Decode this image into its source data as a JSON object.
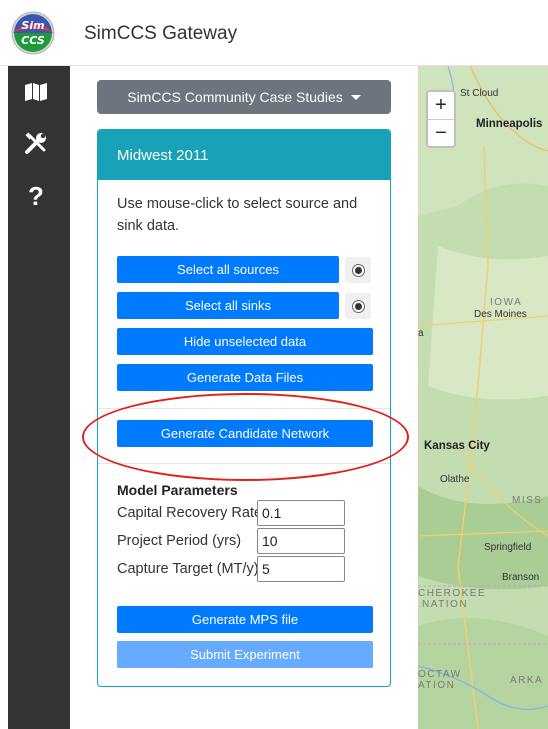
{
  "header": {
    "logo_text": [
      "Sim",
      "CCS"
    ],
    "title": "SimCCS Gateway"
  },
  "sidebar": {
    "icons": [
      "map-icon",
      "tools-icon",
      "question-icon"
    ]
  },
  "dropdown": {
    "label": "SimCCS Community Case Studies"
  },
  "card": {
    "title": "Midwest 2011",
    "instructions": "Use mouse-click to select source and sink data.",
    "buttons": {
      "select_sources": "Select all sources",
      "select_sinks": "Select all sinks",
      "hide_unselected": "Hide unselected data",
      "generate_data_files": "Generate Data Files",
      "generate_candidate_network": "Generate Candidate Network",
      "generate_mps": "Generate MPS file",
      "submit_experiment": "Submit Experiment"
    },
    "params_title": "Model Parameters",
    "params": [
      {
        "label": "Capital Recovery Rate",
        "value": "0.1"
      },
      {
        "label": "Project Period (yrs)",
        "value": "10"
      },
      {
        "label": "Capture Target (MT/y)",
        "value": "5"
      }
    ]
  },
  "map": {
    "zoom_in": "+",
    "zoom_out": "−",
    "labels": {
      "st_cloud": "St Cloud",
      "minneapolis": "Minneapolis",
      "iowa": "IOWA",
      "des_moines": "Des Moines",
      "a": "a",
      "kansas_city": "Kansas City",
      "olathe": "Olathe",
      "missouri": "MISS",
      "springfield": "Springfield",
      "branson": "Branson",
      "cherokee_1": "CHEROKEE",
      "cherokee_2": "NATION",
      "choctaw_1": "OCTAW",
      "choctaw_2": "ATION",
      "arkansas": "ARKA"
    }
  },
  "colors": {
    "primary": "#007bff",
    "info": "#17a2b8",
    "secondary": "#6c757d",
    "sidebar": "#333333",
    "highlight_ellipse": "#e0201a"
  }
}
